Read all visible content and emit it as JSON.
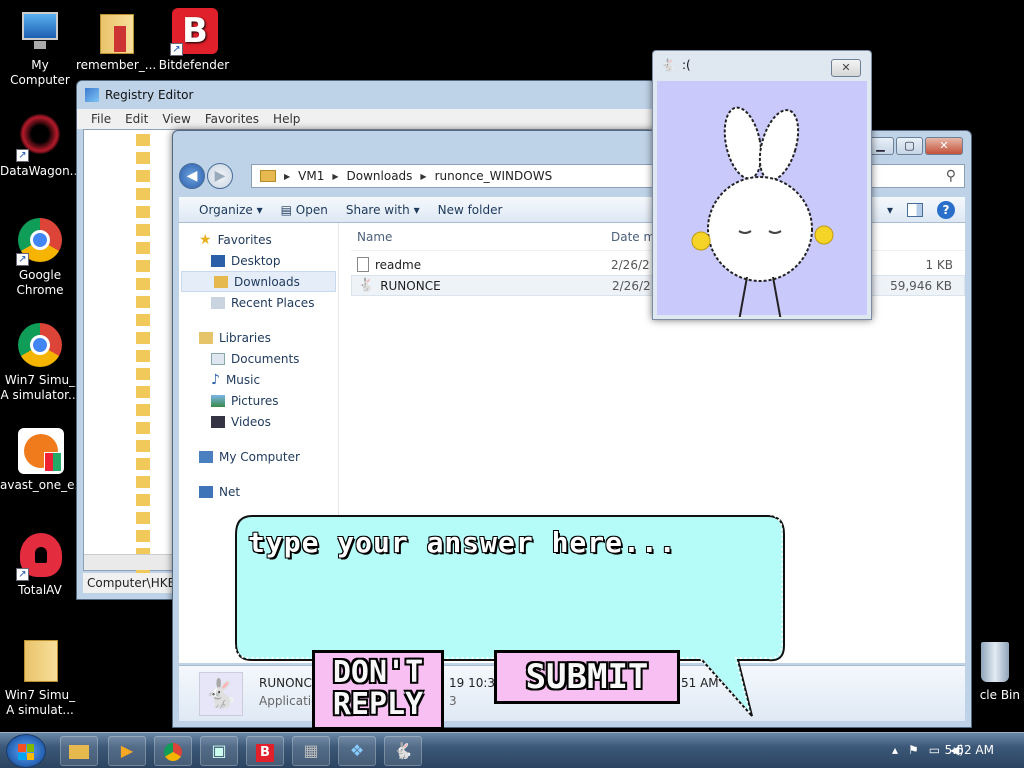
{
  "desktop": {
    "icons": [
      {
        "label": "My Computer"
      },
      {
        "label": "remember_..."
      },
      {
        "label": "Bitdefender"
      },
      {
        "label": "DataWagon..."
      },
      {
        "label": "Google Chrome"
      },
      {
        "label": "Win7 Simu_ A simulator..."
      },
      {
        "label": "avast_one_e..."
      },
      {
        "label": "TotalAV"
      },
      {
        "label": "Win7 Simu_ A simulat..."
      },
      {
        "label": "cle Bin"
      }
    ]
  },
  "regedit": {
    "title": "Registry Editor",
    "menu": [
      "File",
      "Edit",
      "View",
      "Favorites",
      "Help"
    ],
    "status": "Computer\\HKEY"
  },
  "explorer": {
    "breadcrumb": [
      "VM1",
      "Downloads",
      "runonce_WINDOWS"
    ],
    "toolbar": {
      "organize": "Organize",
      "open": "Open",
      "share": "Share with",
      "new_folder": "New folder"
    },
    "nav": {
      "favorites": "Favorites",
      "desktop": "Desktop",
      "downloads": "Downloads",
      "recent": "Recent Places",
      "libraries": "Libraries",
      "documents": "Documents",
      "music": "Music",
      "pictures": "Pictures",
      "videos": "Videos",
      "computer": "My Computer",
      "network": "Net"
    },
    "columns": {
      "name": "Name",
      "date": "Date m",
      "size": "e"
    },
    "files": [
      {
        "name": "readme",
        "date": "2/26/2",
        "size": "1 KB"
      },
      {
        "name": "RUNONCE",
        "date": "2/26/2",
        "size": "59,946 KB"
      }
    ],
    "details": {
      "name": "RUNONC",
      "type": "Applicatio",
      "date": "19 10:36",
      "date2": "3",
      "time": "51 AM"
    }
  },
  "popup": {
    "title": ":("
  },
  "game": {
    "answer_placeholder": "type your answer here...",
    "dont_reply": "DON'T REPLY",
    "submit": "SUBMIT"
  },
  "taskbar": {
    "time": "5:52 AM"
  }
}
